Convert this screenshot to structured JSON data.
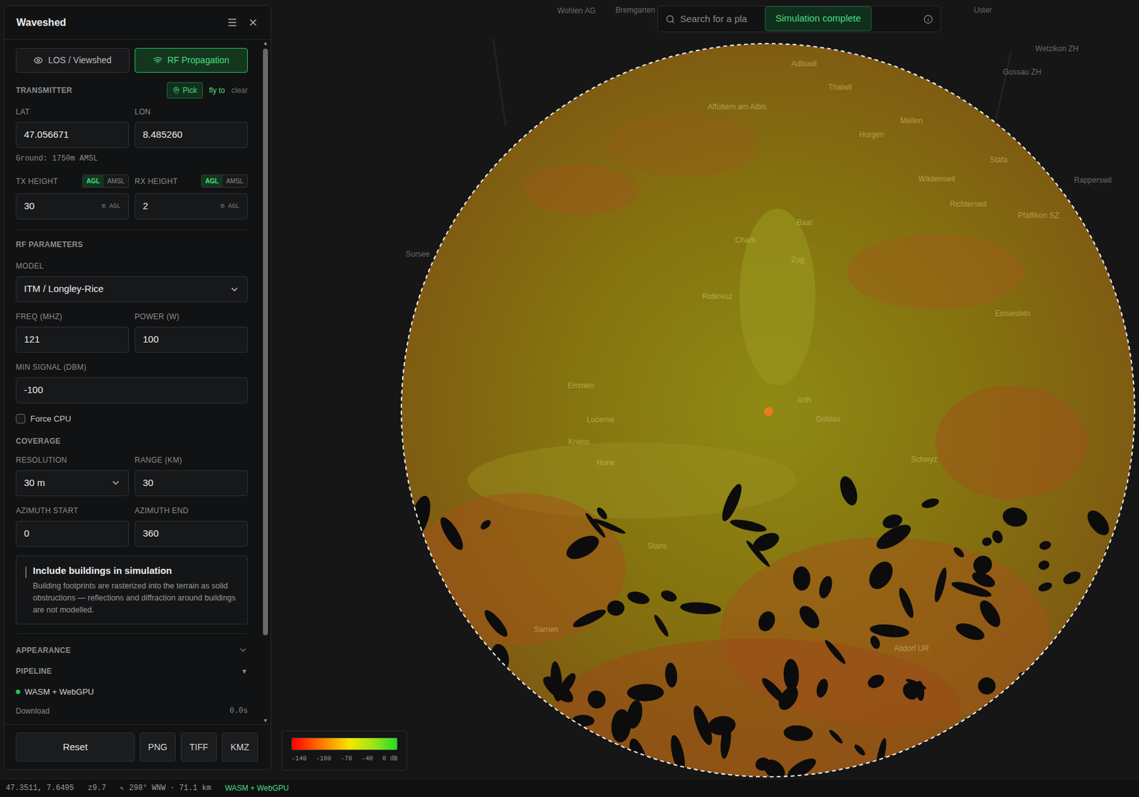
{
  "panel": {
    "title": "Waveshed"
  },
  "tabs": [
    {
      "label": "LOS / Viewshed",
      "selected": false
    },
    {
      "label": "RF Propagation",
      "selected": true
    }
  ],
  "transmitter": {
    "heading": "TRANSMITTER",
    "pick": "Pick",
    "fly_to": "fly to",
    "clear": "clear",
    "lat": {
      "label": "LAT",
      "value": "47.056671"
    },
    "lon": {
      "label": "LON",
      "value": "8.485260"
    },
    "ground": "Ground: 1750m AMSL"
  },
  "heights": [
    {
      "label": "TX HEIGHT",
      "units": [
        {
          "label": "AGL",
          "selected": true
        },
        {
          "label": "AMSL",
          "selected": false
        }
      ],
      "value": "30",
      "suffix": "m AGL"
    },
    {
      "label": "RX HEIGHT",
      "units": [
        {
          "label": "AGL",
          "selected": true
        },
        {
          "label": "AMSL",
          "selected": false
        }
      ],
      "value": "2",
      "suffix": "m AGL"
    }
  ],
  "rf": {
    "heading": "RF PARAMETERS",
    "model": {
      "label": "MODEL",
      "value": "ITM / Longley-Rice"
    },
    "freq": {
      "label": "FREQ (MHZ)",
      "value": "121"
    },
    "power": {
      "label": "POWER (W)",
      "value": "100"
    },
    "min_signal": {
      "label": "MIN SIGNAL (DBM)",
      "value": "-100"
    },
    "force_cpu": {
      "label": "Force CPU",
      "checked": false
    }
  },
  "coverage": {
    "heading": "COVERAGE",
    "resolution": {
      "label": "RESOLUTION",
      "value": "30 m"
    },
    "range": {
      "label": "RANGE (KM)",
      "value": "30"
    },
    "azimuth_start": {
      "label": "AZIMUTH START",
      "value": "0"
    },
    "azimuth_end": {
      "label": "AZIMUTH END",
      "value": "360"
    }
  },
  "buildings": {
    "label": "Include buildings in simulation",
    "checked": false,
    "description": "Building footprints are rasterized into the terrain as solid obstructions — reflections and diffraction around buildings are not modelled."
  },
  "appearance": {
    "label": "APPEARANCE",
    "expanded": false
  },
  "pipeline": {
    "label": "PIPELINE",
    "toggle": "▼",
    "expanded": true,
    "backend": "WASM + WebGPU",
    "rows": [
      {
        "label": "Download",
        "value": "0.0s"
      }
    ]
  },
  "footer_buttons": [
    {
      "label": "Reset",
      "kind": "wide"
    },
    {
      "label": "PNG",
      "kind": "small"
    },
    {
      "label": "TIFF",
      "kind": "small"
    },
    {
      "label": "KMZ",
      "kind": "small"
    }
  ],
  "search": {
    "placeholder": "Search for a pla"
  },
  "toast": "Simulation complete",
  "map_labels": [
    "Wohlen AG",
    "Bremgarten",
    "Uster",
    "Wetzikon ZH",
    "Gossau ZH",
    "Rapperswil",
    "Affoltern am Albis",
    "Adliswil",
    "Thalwil",
    "Meilen",
    "Horgen",
    "Stäfa",
    "Wädenswil",
    "Richterswil",
    "Pfäffikon SZ",
    "Sursee",
    "Cham",
    "Baar",
    "Zug",
    "Rotkreuz",
    "Einsiedeln",
    "Emmen",
    "Lucerne",
    "Kriens",
    "Horw",
    "Arth",
    "Goldau",
    "Schwyz",
    "Stans",
    "Sarnen",
    "Altdorf UR"
  ],
  "legend": {
    "ticks": [
      "-140",
      "-100",
      "-70",
      "-40",
      "0 dB"
    ]
  },
  "status_bar": {
    "coords": "47.3511, 7.6495",
    "zoom": "z9.7",
    "bearing": "↖ 298° WNW · 71.1 km",
    "backend": "WASM + WebGPU"
  }
}
